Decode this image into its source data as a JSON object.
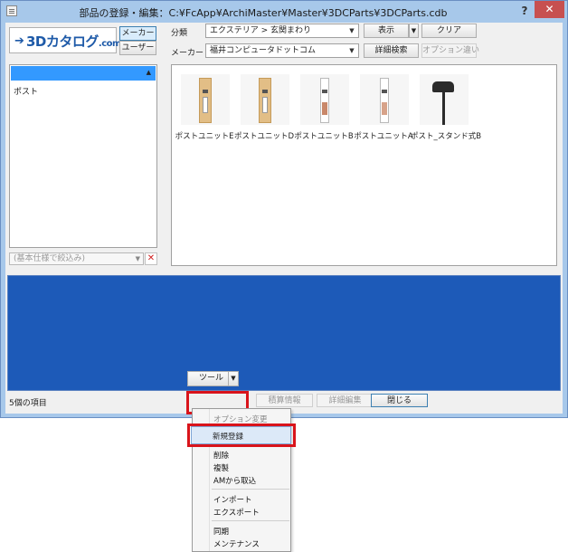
{
  "window": {
    "title": "部品の登録・編集：C:¥FcApp¥ArchiMaster¥Master¥3DCParts¥3DCParts.cdb",
    "help": "?",
    "close": "✕"
  },
  "logo": {
    "arrow": "➔",
    "text": "3Dカタログ",
    "suffix": ".com"
  },
  "source_tabs": {
    "maker": "メーカー",
    "user": "ユーザー"
  },
  "filters": {
    "category_label": "分類",
    "category_value": "エクステリア > 玄関まわり",
    "maker_label": "メーカー",
    "maker_value": "福井コンピュータドットコム"
  },
  "toolbar": {
    "display": "表示",
    "clear": "クリア",
    "detail_search": "詳細検索",
    "option_diff": "オプション違い"
  },
  "left_list": {
    "items": [
      "ポスト"
    ],
    "filter_placeholder": "(基本仕様で絞込み)",
    "clear_icon": "✕"
  },
  "parts": [
    {
      "label": "ポストユニットE"
    },
    {
      "label": "ポストユニットD"
    },
    {
      "label": "ポストユニットB"
    },
    {
      "label": "ポストユニットA"
    },
    {
      "label": "ポスト_スタンド式B"
    }
  ],
  "status": "5個の項目",
  "bottom_buttons": {
    "tool": "ツール",
    "quantity_info": "積算情報",
    "detail_edit": "詳細編集",
    "close": "閉じる"
  },
  "tool_menu": {
    "items": [
      "オプション変更",
      "新規登録",
      "削除",
      "複製",
      "AMから取込",
      "インポート",
      "エクスポート",
      "同期",
      "メンテナンス"
    ],
    "highlighted": "新規登録"
  },
  "colors": {
    "preview_bg": "#1d5ab8",
    "accent_red": "#d9141b",
    "selection": "#3399ff"
  }
}
